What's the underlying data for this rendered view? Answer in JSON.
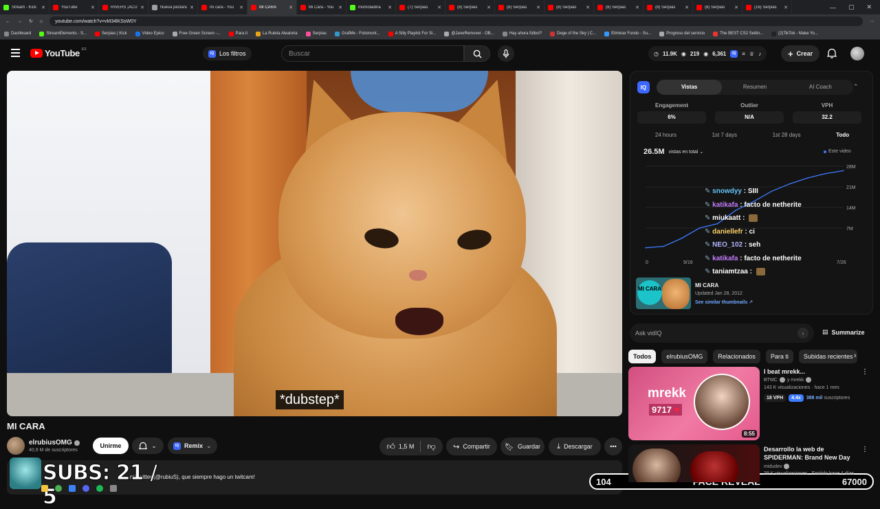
{
  "browser": {
    "tabs": [
      {
        "label": "Stream - Kick",
        "color": "#53fc18"
      },
      {
        "label": "YouTube",
        "color": "#ff0000"
      },
      {
        "label": "RIVERS ¡ACUS",
        "color": "#ff0000"
      },
      {
        "label": "Nueva pestaña",
        "color": "#9aa0a6"
      },
      {
        "label": "mi cara - You",
        "color": "#ff0000"
      },
      {
        "label": "MI CARA",
        "color": "#ff0000",
        "active": true
      },
      {
        "label": "Mi Cara - You",
        "color": "#ff0000"
      },
      {
        "label": "momoladina",
        "color": "#53fc18"
      },
      {
        "label": "(7) Serpias",
        "color": "#ff0000"
      },
      {
        "label": "(8) Serpias",
        "color": "#ff0000"
      },
      {
        "label": "(8) Serpias",
        "color": "#ff0000"
      },
      {
        "label": "(8) Serpias",
        "color": "#ff0000"
      },
      {
        "label": "(8) Serpias",
        "color": "#ff0000"
      },
      {
        "label": "(8) Serpias",
        "color": "#ff0000"
      },
      {
        "label": "(8) Serpias",
        "color": "#ff0000"
      },
      {
        "label": "(16) Serpias",
        "color": "#ff0000"
      }
    ],
    "url": "youtube.com/watch?v=vM34lKSsW0Y",
    "bookmarks": [
      "Dashboard",
      "StreamElements - S...",
      "Serpias | Kick",
      "Video Epico",
      "Free Green Screen -...",
      "Para ti",
      "La Ruleta Aleatoria",
      "Serpias",
      "GrafMe - Fotomont...",
      "A Silly Playlist For Si...",
      "@JaneRemover - OB...",
      "Hay ahora fútbol?",
      "Dege of the Sky | C...",
      "Eliminar Fondo - Su...",
      "Progreso del servicio",
      "The BEST CS2 Settin...",
      "(2)TikTok - Make Yo..."
    ]
  },
  "header": {
    "logo_text": "YouTube",
    "logo_country": "ES",
    "filter_label": "Los filtros",
    "search_placeholder": "Buscar",
    "stat_subs": "11.9K",
    "stat_views": "219",
    "stat_views2": "6,361",
    "create_label": "Crear"
  },
  "video": {
    "caption": "*dubstep*",
    "title": "MI CARA",
    "channel": "elrubiusOMG",
    "subscribers": "40,9 M de suscriptores",
    "join_label": "Unirme",
    "remix_label": "Remix",
    "likes": "1,5 M",
    "share_label": "Compartir",
    "save_label": "Guardar",
    "download_label": "Descargar",
    "description": "... mi twitter (@rubiuS), que siempre hago un twitcam!"
  },
  "overlay": {
    "subs_text": "SUBS: 21 / 5",
    "face_left": "104",
    "face_center": "FACE REVEAL",
    "face_right": "67000"
  },
  "vidiq": {
    "logo": "IQ",
    "tabs": [
      "Vistas",
      "Resumen",
      "AI Coach"
    ],
    "metrics": [
      {
        "label": "Engagement",
        "value": "6%"
      },
      {
        "label": "Outlier",
        "value": "N/A"
      },
      {
        "label": "VPH",
        "value": "32.2"
      }
    ],
    "ranges": [
      "24 hours",
      "1st 7 days",
      "1st 28 days",
      "Todo"
    ],
    "total_views": "26.5M",
    "views_select": "vistas en total",
    "legend": "Este video",
    "thumb_title": "MI CARA",
    "thumb_text": "MI CARA",
    "thumb_updated": "Updated Jan 28, 2012",
    "thumb_link": "See similar thumbnails",
    "ask_placeholder": "Ask vidIQ",
    "summarize_label": "Summarize"
  },
  "chart_data": {
    "type": "line",
    "x": [
      "0",
      "",
      "",
      "",
      "",
      "",
      "",
      "",
      "",
      "",
      "",
      ""
    ],
    "x_ticks": [
      "0",
      "9/16",
      "7/26"
    ],
    "y_ticks": [
      "28M",
      "21M",
      "14M",
      "7M"
    ],
    "series": [
      {
        "values": [
          0.3,
          0.8,
          3.5,
          7,
          8.5,
          13,
          16,
          19.5,
          22,
          24,
          25.5,
          26.5
        ]
      }
    ],
    "ylim": [
      0,
      28
    ],
    "grid": true
  },
  "chat": [
    {
      "user": "snowdyy",
      "color": "#66c7ff",
      "msg": "SIII"
    },
    {
      "user": "katikafa",
      "color": "#c77dff",
      "msg": "facto de netherite"
    },
    {
      "user": "miukaatt",
      "color": "#ffffff",
      "msg": ""
    },
    {
      "user": "daniellefr",
      "color": "#ffd36b",
      "msg": "ci"
    },
    {
      "user": "NEO_102",
      "color": "#b3b3ff",
      "msg": "seh"
    },
    {
      "user": "katikafa",
      "color": "#c77dff",
      "msg": "facto de netherite"
    },
    {
      "user": "taniamtzaa",
      "color": "#ffffff",
      "msg": ""
    }
  ],
  "chips": [
    "Todos",
    "elrubiusOMG",
    "Relacionados",
    "Para ti",
    "Subidas recientes"
  ],
  "recommendations": [
    {
      "title": "I beat mrekk...",
      "channel": "BTMC",
      "channel2": "y mrekk",
      "meta": "143 K visualizaciones · hace 1 mes",
      "duration": "8:55",
      "thumb_text": "mrekk",
      "thumb_num": "9717",
      "vph": "18 VPH",
      "multiplier": "4.4x",
      "subs": "388 mil",
      "subs_suffix": "suscriptores"
    },
    {
      "title": "Desarrollo la web de SPIDERMAN: Brand New Day",
      "channel": "midudev",
      "meta": "39 K visualizaciones · Emitido hace 4 días"
    }
  ]
}
